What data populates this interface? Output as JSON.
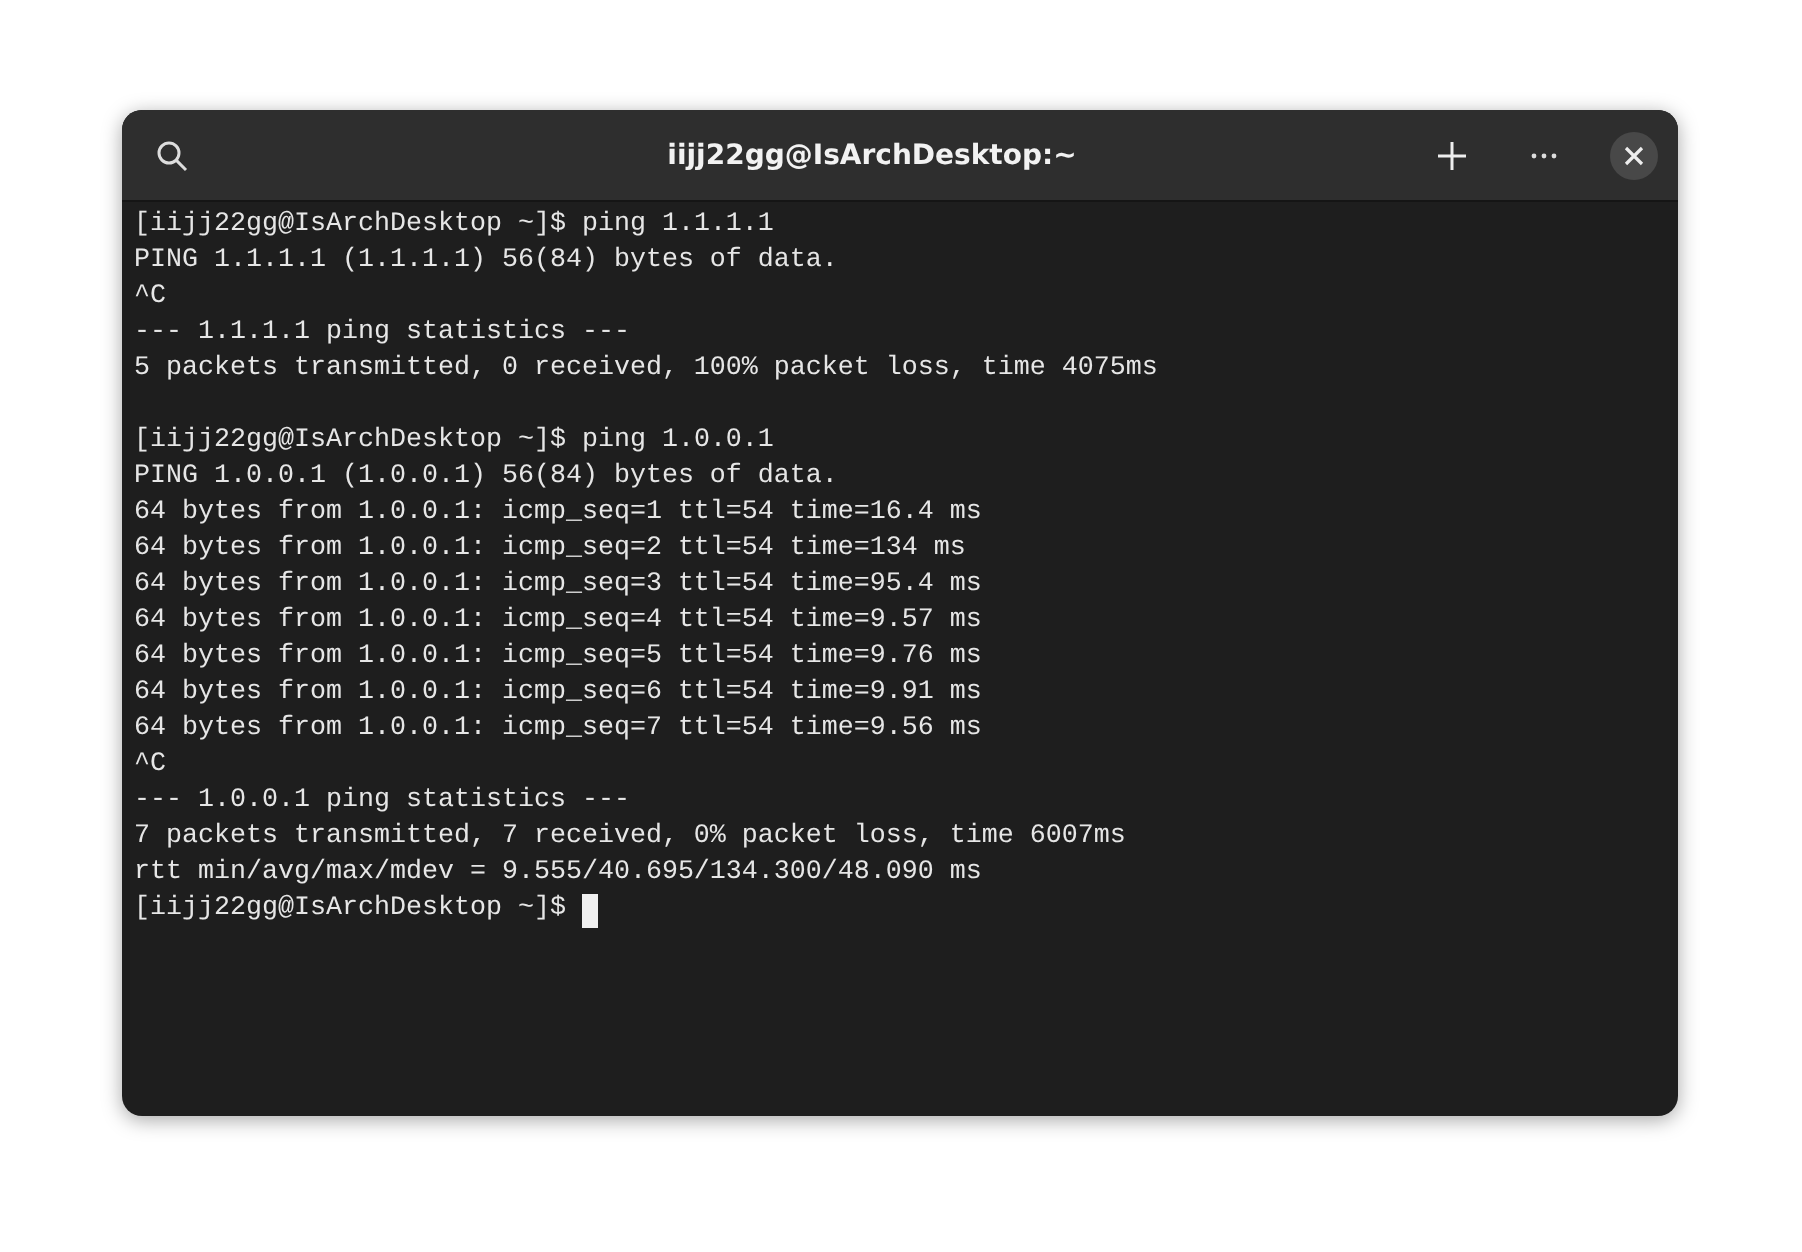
{
  "window": {
    "title": "iijj22gg@IsArchDesktop:~"
  },
  "terminal": {
    "sessions": [
      {
        "lines": [
          {
            "kind": "command",
            "prompt": "[iijj22gg@IsArchDesktop ~]$",
            "text": "ping 1.1.1.1"
          },
          {
            "kind": "output",
            "text": "PING 1.1.1.1 (1.1.1.1) 56(84) bytes of data."
          },
          {
            "kind": "output",
            "text": "^C"
          },
          {
            "kind": "output",
            "text": "--- 1.1.1.1 ping statistics ---"
          },
          {
            "kind": "output",
            "text": "5 packets transmitted, 0 received, 100% packet loss, time 4075ms"
          }
        ]
      },
      {
        "lines": [
          {
            "kind": "command",
            "prompt": "[iijj22gg@IsArchDesktop ~]$",
            "text": "ping 1.0.0.1"
          },
          {
            "kind": "output",
            "text": "PING 1.0.0.1 (1.0.0.1) 56(84) bytes of data."
          },
          {
            "kind": "output",
            "text": "64 bytes from 1.0.0.1: icmp_seq=1 ttl=54 time=16.4 ms"
          },
          {
            "kind": "output",
            "text": "64 bytes from 1.0.0.1: icmp_seq=2 ttl=54 time=134 ms"
          },
          {
            "kind": "output",
            "text": "64 bytes from 1.0.0.1: icmp_seq=3 ttl=54 time=95.4 ms"
          },
          {
            "kind": "output",
            "text": "64 bytes from 1.0.0.1: icmp_seq=4 ttl=54 time=9.57 ms"
          },
          {
            "kind": "output",
            "text": "64 bytes from 1.0.0.1: icmp_seq=5 ttl=54 time=9.76 ms"
          },
          {
            "kind": "output",
            "text": "64 bytes from 1.0.0.1: icmp_seq=6 ttl=54 time=9.91 ms"
          },
          {
            "kind": "output",
            "text": "64 bytes from 1.0.0.1: icmp_seq=7 ttl=54 time=9.56 ms"
          },
          {
            "kind": "output",
            "text": "^C"
          },
          {
            "kind": "output",
            "text": "--- 1.0.0.1 ping statistics ---"
          },
          {
            "kind": "output",
            "text": "7 packets transmitted, 7 received, 0% packet loss, time 6007ms"
          },
          {
            "kind": "output",
            "text": "rtt min/avg/max/mdev = 9.555/40.695/134.300/48.090 ms"
          },
          {
            "kind": "input",
            "prompt": "[iijj22gg@IsArchDesktop ~]$",
            "cursor": true
          }
        ]
      }
    ]
  }
}
